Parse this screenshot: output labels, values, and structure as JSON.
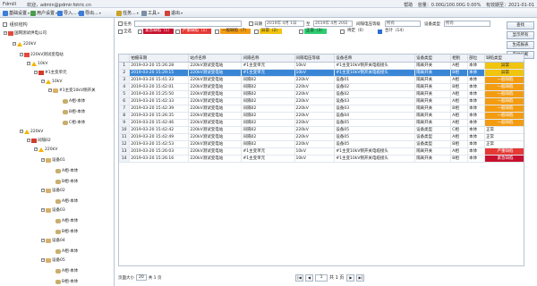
{
  "titlebar": {
    "app": "Fdmill",
    "welcome": "欢迎，admin@pdmir.fotric.cn",
    "help": "帮助",
    "volume": "容量：0.00G/100.00G 0.00%",
    "expiry": "有效期至：2021-01-01"
  },
  "toolbar": {
    "items": [
      {
        "label": "基础设置",
        "icon": "settings-icon",
        "color": "#3b7dd8"
      },
      {
        "label": "用户设置",
        "icon": "user-icon",
        "color": "#4a9d4a"
      },
      {
        "label": "导入...",
        "icon": "import-icon",
        "color": "#3b7dd8"
      },
      {
        "label": "导出...",
        "icon": "export-icon",
        "color": "#3b7dd8"
      },
      {
        "label": "任务...",
        "icon": "task-icon",
        "color": "#c9a227"
      },
      {
        "label": "工具",
        "icon": "tool-icon",
        "color": "#7a8ea6"
      },
      {
        "label": "退出",
        "icon": "exit-icon",
        "color": "#d0433a"
      }
    ]
  },
  "tree": {
    "header": "组织结构",
    "nodes": [
      {
        "label": "国网测试供电公司",
        "icon": "org",
        "toggle": "−"
      },
      {
        "label": "220kV",
        "icon": "warn",
        "toggle": "−"
      },
      {
        "label": "220kV测试变电站",
        "icon": "org",
        "toggle": "−"
      },
      {
        "label": "10kV",
        "icon": "warn",
        "toggle": "−"
      },
      {
        "label": "#1主变单元",
        "icon": "red",
        "toggle": "−"
      },
      {
        "label": "10kV",
        "icon": "warn",
        "toggle": "−"
      },
      {
        "label": "#1主变10kV侧开关",
        "icon": "dev",
        "toggle": "−"
      },
      {
        "label": "A相-本体",
        "icon": "item",
        "toggle": ""
      },
      {
        "label": "B相-本体",
        "icon": "item",
        "toggle": ""
      },
      {
        "label": "C相-本体",
        "icon": "item",
        "toggle": ""
      },
      {
        "label": "220kV",
        "icon": "warn",
        "toggle": "−"
      },
      {
        "label": "间隔02",
        "icon": "red",
        "toggle": "−"
      },
      {
        "label": "220kV",
        "icon": "warn",
        "toggle": "−"
      },
      {
        "label": "设备01",
        "icon": "dev",
        "toggle": "−"
      },
      {
        "label": "A相-本体",
        "icon": "item",
        "toggle": ""
      },
      {
        "label": "B相-本体",
        "icon": "item",
        "toggle": ""
      },
      {
        "label": "设备02",
        "icon": "dev",
        "toggle": "−"
      },
      {
        "label": "A相-本体",
        "icon": "item",
        "toggle": ""
      },
      {
        "label": "设备03",
        "icon": "dev",
        "toggle": "−"
      },
      {
        "label": "A相-本体",
        "icon": "item",
        "toggle": ""
      },
      {
        "label": "B相-本体",
        "icon": "item",
        "toggle": ""
      },
      {
        "label": "设备04",
        "icon": "dev",
        "toggle": "−"
      },
      {
        "label": "A相-本体",
        "icon": "item",
        "toggle": ""
      },
      {
        "label": "设备05",
        "icon": "dev",
        "toggle": "−"
      },
      {
        "label": "A相-本体",
        "icon": "item",
        "toggle": ""
      },
      {
        "label": "B相-本体",
        "icon": "item",
        "toggle": ""
      },
      {
        "label": "C相-本体",
        "icon": "item",
        "toggle": ""
      }
    ]
  },
  "filters": {
    "task_label": "任务",
    "date_label": "日期",
    "date_from": "2019年 4月 1日",
    "date_sep": "至",
    "date_to": "2019年 4月 20日",
    "voltage_label": "间隔电压等级",
    "voltage_value": "所有",
    "devtype_label": "设备类型",
    "devtype_value": "所有",
    "all_label": "全选",
    "legend": [
      {
        "label": "紧急缺陷",
        "count": "（1）",
        "color": "#c8102e",
        "checked": false
      },
      {
        "label": "严重缺陷",
        "count": "（1）",
        "color": "#e53935",
        "checked": false
      },
      {
        "label": "一般缺陷",
        "count": "（7）",
        "color": "#f39c12",
        "checked": false
      },
      {
        "label": "异常",
        "count": "（2）",
        "color": "#f1c40f",
        "checked": false
      },
      {
        "label": "正常",
        "count": "（3）",
        "color": "#2ecc71",
        "checked": false
      },
      {
        "label": "待定",
        "count": "（0）",
        "color": "#ffffff",
        "checked": false
      },
      {
        "label": "合计",
        "count": "（14）",
        "color": "#ffffff",
        "checked": true
      }
    ]
  },
  "side_buttons": [
    "查找",
    "显示所有",
    "生成报表",
    "自动诊断"
  ],
  "table": {
    "columns": [
      "",
      "拍摄日期",
      "站点名称",
      "间隔名称",
      "间隔电压等级",
      "设备名称",
      "设备类型",
      "相别",
      "部位",
      "缺陷类型"
    ],
    "rows": [
      {
        "n": "1",
        "date": "2019-03-20 15:26:28",
        "site": "220kV测试变电站",
        "bay": "#1主变单元",
        "volt": "10kV",
        "dev": "#1主变10kV侧开关电缆接头",
        "type": "隔离开关",
        "phase": "A相",
        "part": "本体",
        "defect": "异常",
        "dcolor": "#f1c40f"
      },
      {
        "n": "2",
        "date": "2019-03-20 15:29:15",
        "site": "220kV测试变电站",
        "bay": "#1主变单元",
        "volt": "10kV",
        "dev": "#1主变10kV侧开关电缆接头",
        "type": "隔离开关",
        "phase": "B相",
        "part": "本体",
        "defect": "异常",
        "dcolor": "#f1c40f"
      },
      {
        "n": "3",
        "date": "2019-03-20 15:41:33",
        "site": "220kV测试变电站",
        "bay": "间隔02",
        "volt": "220kV",
        "dev": "设备01",
        "type": "隔离开关",
        "phase": "A相",
        "part": "本体",
        "defect": "一般缺陷",
        "dcolor": "#f39c12"
      },
      {
        "n": "4",
        "date": "2019-03-20 15:42:01",
        "site": "220kV测试变电站",
        "bay": "间隔02",
        "volt": "220kV",
        "dev": "设备02",
        "type": "隔离开关",
        "phase": "B相",
        "part": "本体",
        "defect": "一般缺陷",
        "dcolor": "#f39c12"
      },
      {
        "n": "5",
        "date": "2019-03-20 15:25:50",
        "site": "220kV测试变电站",
        "bay": "间隔02",
        "volt": "220kV",
        "dev": "设备02",
        "type": "隔离开关",
        "phase": "A相",
        "part": "本体",
        "defect": "一般缺陷",
        "dcolor": "#f39c12"
      },
      {
        "n": "6",
        "date": "2019-03-20 15:42:33",
        "site": "220kV测试变电站",
        "bay": "间隔02",
        "volt": "220kV",
        "dev": "设备03",
        "type": "隔离开关",
        "phase": "A相",
        "part": "本体",
        "defect": "一般缺陷",
        "dcolor": "#f39c12"
      },
      {
        "n": "7",
        "date": "2019-03-20 15:42:39",
        "site": "220kV测试变电站",
        "bay": "间隔02",
        "volt": "220kV",
        "dev": "设备03",
        "type": "隔离开关",
        "phase": "B相",
        "part": "本体",
        "defect": "一般缺陷",
        "dcolor": "#f39c12"
      },
      {
        "n": "8",
        "date": "2019-03-20 15:26:35",
        "site": "220kV测试变电站",
        "bay": "间隔02",
        "volt": "220kV",
        "dev": "设备04",
        "type": "隔离开关",
        "phase": "A相",
        "part": "本体",
        "defect": "一般缺陷",
        "dcolor": "#f39c12"
      },
      {
        "n": "9",
        "date": "2019-03-20 15:42:46",
        "site": "220kV测试变电站",
        "bay": "间隔02",
        "volt": "220kV",
        "dev": "设备05",
        "type": "隔离开关",
        "phase": "A相",
        "part": "本体",
        "defect": "一般缺陷",
        "dcolor": "#f39c12"
      },
      {
        "n": "10",
        "date": "2019-03-20 15:42:42",
        "site": "220kV测试变电站",
        "bay": "间隔02",
        "volt": "220kV",
        "dev": "设备05",
        "type": "设备类型",
        "phase": "C相",
        "part": "本体",
        "defect": "正常",
        "dcolor": ""
      },
      {
        "n": "11",
        "date": "2019-03-20 15:42:49",
        "site": "220kV测试变电站",
        "bay": "间隔02",
        "volt": "220kV",
        "dev": "设备05",
        "type": "设备类型",
        "phase": "A相",
        "part": "本体",
        "defect": "正常",
        "dcolor": ""
      },
      {
        "n": "12",
        "date": "2019-03-20 15:42:53",
        "site": "220kV测试变电站",
        "bay": "间隔02",
        "volt": "220kV",
        "dev": "设备05",
        "type": "设备类型",
        "phase": "B相",
        "part": "本体",
        "defect": "正常",
        "dcolor": ""
      },
      {
        "n": "13",
        "date": "2019-03-20 15:26:03",
        "site": "220kV测试变电站",
        "bay": "#1主变单元",
        "volt": "10kV",
        "dev": "#1主变10kV侧开关电缆接头",
        "type": "隔离开关",
        "phase": "A相",
        "part": "本体",
        "defect": "严重缺陷",
        "dcolor": "#e53935"
      },
      {
        "n": "14",
        "date": "2019-03-20 15:26:16",
        "site": "220kV测试变电站",
        "bay": "#1主变单元",
        "volt": "10kV",
        "dev": "#1主变10kV侧开关电缆接头",
        "type": "隔离开关",
        "phase": "B相",
        "part": "本体",
        "defect": "紧急缺陷",
        "dcolor": "#c8102e"
      }
    ]
  },
  "pager": {
    "size_label": "页面大小",
    "size_value": "20",
    "page_info": "共 1 页",
    "total": "共 1 页",
    "current": "1",
    "first": "|◀",
    "prev": "◀",
    "next": "▶",
    "last": "▶|"
  }
}
